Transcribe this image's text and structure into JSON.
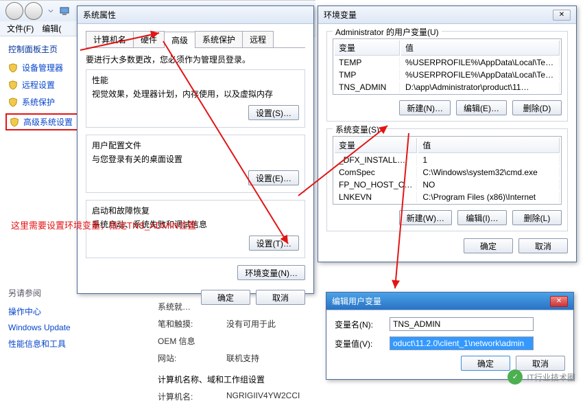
{
  "bg": {
    "menu_file": "文件(F)",
    "menu_edit": "编辑(",
    "cp_home": "控制面板主页",
    "items": [
      "设备管理器",
      "远程设置",
      "系统保护",
      "高级系统设置"
    ],
    "see_also_title": "另请参阅",
    "see_also": [
      "操作中心",
      "Windows Update",
      "性能信息和工具"
    ]
  },
  "midcol": {
    "sys_rating": "系统就…",
    "pen_touch_k": "笔和触摸:",
    "pen_touch_v": "没有可用于此",
    "oem_k": "OEM 信息",
    "site_k": "网站:",
    "site_v": "联机支持",
    "name_section": "计算机名称、域和工作组设置",
    "comp_name_k": "计算机名:",
    "comp_name_v": "NGRIGIIV4YW2CCI"
  },
  "sysprop": {
    "title": "系统属性",
    "tabs": [
      "计算机名",
      "硬件",
      "高级",
      "系统保护",
      "远程"
    ],
    "admin_note": "要进行大多数更改，您必须作为管理员登录。",
    "perf_title": "性能",
    "perf_desc": "视觉效果，处理器计划，内存使用，以及虚拟内存",
    "profile_title": "用户配置文件",
    "profile_desc": "与您登录有关的桌面设置",
    "startup_title": "启动和故障恢复",
    "startup_desc": "系统启动、系统失败和调试信息",
    "settings_btn": "设置(S)…",
    "settings_btn2": "设置(E)…",
    "settings_btn3": "设置(T)…",
    "envvar_btn": "环境变量(N)…",
    "ok": "确定",
    "cancel": "取消"
  },
  "envdlg": {
    "title": "环境变量",
    "user_legend": "Administrator 的用户变量(U)",
    "sys_legend": "系统变量(S)",
    "col_var": "变量",
    "col_val": "值",
    "user_rows": [
      {
        "k": "TEMP",
        "v": "%USERPROFILE%\\AppData\\Local\\Temp"
      },
      {
        "k": "TMP",
        "v": "%USERPROFILE%\\AppData\\Local\\Temp"
      },
      {
        "k": "TNS_ADMIN",
        "v": "D:\\app\\Administrator\\product\\11…"
      }
    ],
    "sys_rows": [
      {
        "k": "_DFX_INSTALL…",
        "v": "1"
      },
      {
        "k": "ComSpec",
        "v": "C:\\Windows\\system32\\cmd.exe"
      },
      {
        "k": "FP_NO_HOST_C…",
        "v": "NO"
      },
      {
        "k": "LNKEVN",
        "v": "C:\\Program Files (x86)\\Internet"
      }
    ],
    "new_btn_u": "新建(N)…",
    "edit_btn_u": "编辑(E)…",
    "del_btn_u": "删除(D)",
    "new_btn_s": "新建(W)…",
    "edit_btn_s": "编辑(I)…",
    "del_btn_s": "删除(L)",
    "ok": "确定",
    "cancel": "取消"
  },
  "editdlg": {
    "title": "编辑用户变量",
    "name_lbl": "变量名(N):",
    "name_val": "TNS_ADMIN",
    "val_lbl": "变量值(V):",
    "val_val": "oduct\\11.2.0\\client_1\\network\\admin",
    "ok": "确定",
    "cancel": "取消"
  },
  "annotation": "这里需要设置环境变量，指定TNS_ADMIN位置",
  "watermark": "IT行业技术圈"
}
